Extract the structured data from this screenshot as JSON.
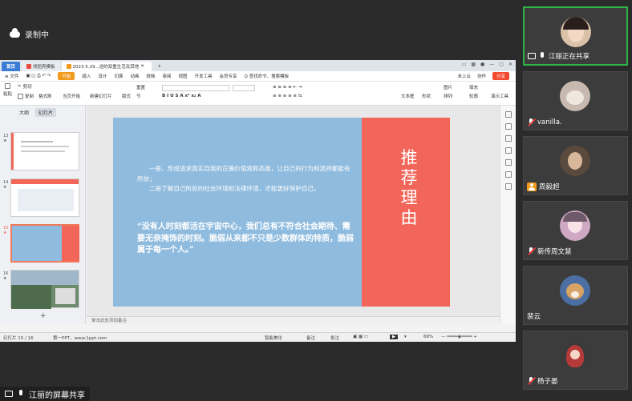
{
  "recording": {
    "label": "录制中"
  },
  "wps": {
    "tabs": [
      {
        "label": "首页"
      },
      {
        "label": "找稻壳模板"
      },
      {
        "label": "2023.5.29...途的双重生活及其他"
      }
    ],
    "menu": [
      "≡ 文件",
      "开始",
      "插入",
      "设计",
      "切换",
      "动画",
      "放映",
      "审阅",
      "视图",
      "开发工具",
      "会员专享"
    ],
    "search_placeholder": "Q 查找命令、搜索模板",
    "menu_right": {
      "unsaved": "未上云",
      "collab": "协作",
      "share": "分享"
    },
    "ribbon": {
      "paste": "粘贴",
      "cut": "剪切",
      "copy": "复制",
      "format_painter": "格式刷",
      "start_show": "当页开始",
      "new_slide": "新建幻灯片",
      "layout": "版式",
      "section": "节",
      "reset": "重置",
      "textbox": "文本框",
      "shape": "形状",
      "arrange": "排列",
      "picture": "图片",
      "fill": "填充",
      "outline": "轮廓",
      "presenter": "演示工具"
    },
    "panel_tabs": [
      "大纲",
      "幻灯片"
    ],
    "thumbnails": [
      {
        "num": "13",
        "star": "★"
      },
      {
        "num": "14",
        "star": "★"
      },
      {
        "num": "15",
        "star": "★"
      },
      {
        "num": "16",
        "star": "★"
      }
    ],
    "slide": {
      "title": "推荐理由",
      "paragraph1": "一是，形成追求真实自我的正确价值观和态度，让自己的行为和选择都能有所依；",
      "paragraph2": "二是了解自己所处的社会环境和法律环境，才能更好保护自己。",
      "quote": "“没有人时刻都活在宇宙中心，我们总有不符合社会期待、需要无奈掩饰的时刻。脆弱从来都不只是少数群体的特质，脆弱属于每一个人。”"
    },
    "notes_placeholder": "单击此处添加备注",
    "status": {
      "slide_pos": "幻灯片 15 / 16",
      "theme": "第一PPT，www.1ppt.com",
      "beautify": "智能美化",
      "notes": "备注",
      "comment": "批注",
      "zoom": "68%"
    }
  },
  "participants": [
    {
      "name": "江丽正在共享",
      "state": "sharing"
    },
    {
      "name": "vanilla.",
      "state": "muted"
    },
    {
      "name": "周毅超",
      "state": "no-video"
    },
    {
      "name": "新传周文慧",
      "state": "muted"
    },
    {
      "name": "裴云",
      "state": "none"
    },
    {
      "name": "杨子晏",
      "state": "muted"
    }
  ],
  "screen_share_label": "江丽的屏幕共享",
  "colors": {
    "slide_blue": "#8fbbde",
    "slide_red": "#f2665a",
    "active_border": "#2fb24a",
    "wps_start": "#f19a1c"
  }
}
